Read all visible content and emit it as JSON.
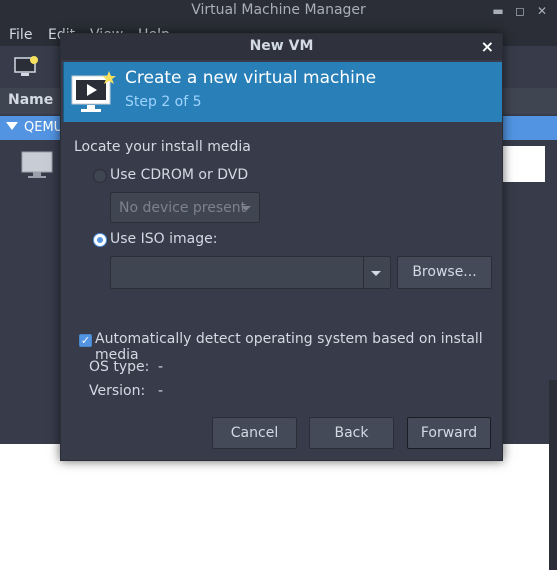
{
  "main_window": {
    "title": "Virtual Machine Manager",
    "menu": [
      "File",
      "Edit",
      "View",
      "Help"
    ],
    "list_header": "Name",
    "connection": "QEMU"
  },
  "dialog": {
    "title": "New VM",
    "close_glyph": "×",
    "banner": {
      "title": "Create a new virtual machine",
      "step": "Step 2 of 5"
    },
    "section_label": "Locate your install media",
    "option_cdrom": {
      "label": "Use CDROM or DVD",
      "selected": false,
      "device_combo": "No device present"
    },
    "option_iso": {
      "label": "Use ISO image:",
      "selected": true,
      "path_value": "",
      "browse_label": "Browse..."
    },
    "autodetect": {
      "label": "Automatically detect operating system based on install media",
      "checked": true
    },
    "os_type": {
      "label": "OS type:",
      "value": "-"
    },
    "version": {
      "label": "Version:",
      "value": "-"
    },
    "buttons": {
      "cancel": "Cancel",
      "back": "Back",
      "forward": "Forward"
    }
  },
  "colors": {
    "banner": "#2980b9",
    "accent": "#5294e2",
    "dialog_bg": "#383c4a",
    "titlebar_bg": "#2b2e37"
  }
}
